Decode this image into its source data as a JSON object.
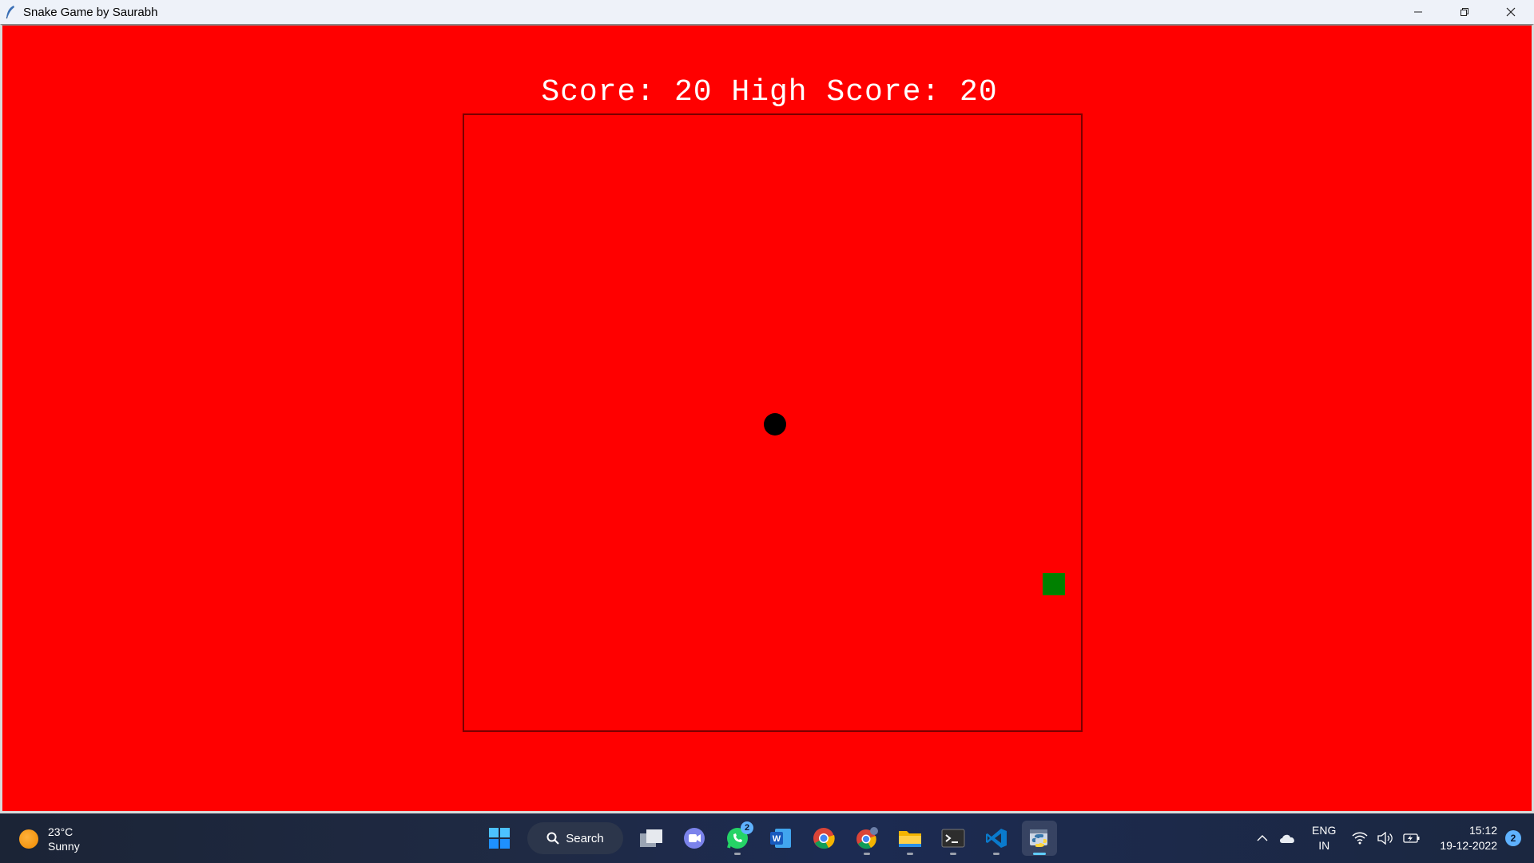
{
  "window": {
    "title": "Snake Game by Saurabh",
    "app_icon": "feather-icon",
    "controls": [
      "minimize-icon",
      "restore-icon",
      "close-icon"
    ]
  },
  "game": {
    "background_color": "#ff0000",
    "score_label": "Score:",
    "score": "20",
    "high_score_label": "High Score:",
    "high_score": "20",
    "snake_color": "#000000",
    "food_color": "#008000"
  },
  "taskbar": {
    "weather": {
      "temp": "23°C",
      "condition": "Sunny",
      "icon": "sun-icon"
    },
    "search_label": "Search",
    "apps": [
      {
        "name": "start-icon"
      },
      {
        "name": "task-view-icon"
      },
      {
        "name": "teams-chat-icon"
      },
      {
        "name": "whatsapp-icon",
        "badge": "2"
      },
      {
        "name": "word-icon"
      },
      {
        "name": "chrome-icon"
      },
      {
        "name": "chrome-profile-icon"
      },
      {
        "name": "file-explorer-icon"
      },
      {
        "name": "terminal-icon"
      },
      {
        "name": "vscode-icon"
      },
      {
        "name": "python-icon",
        "active": true
      }
    ],
    "tray": {
      "language_line1": "ENG",
      "language_line2": "IN",
      "time": "15:12",
      "date": "19-12-2022",
      "notification_count": "2"
    }
  }
}
